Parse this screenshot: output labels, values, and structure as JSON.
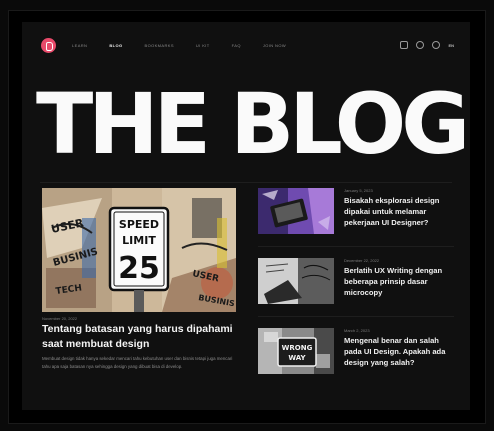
{
  "nav": {
    "logo_letter": "",
    "items": [
      {
        "label": "LEARN",
        "active": false
      },
      {
        "label": "BLOG",
        "active": true
      },
      {
        "label": "BOOKMARKS",
        "active": false
      },
      {
        "label": "UI KIT",
        "active": false
      },
      {
        "label": "FAQ",
        "active": false
      },
      {
        "label": "JOIN NOW",
        "active": false
      }
    ],
    "lang": "EN",
    "social_icons": [
      "twitter-icon",
      "instagram-icon",
      "dribbble-icon"
    ]
  },
  "hero": {
    "title": "THE BLOG"
  },
  "featured": {
    "image_sign_top": "SPEED",
    "image_sign_mid": "LIMIT",
    "image_sign_num": "25",
    "date": "November 20, 2022",
    "title": "Tentang batasan yang harus dipahami saat membuat design",
    "excerpt": "Membuat design tidak hanya sekedar mencari tahu kebutuhan user dan bisnis tetapi juga mencari tahu apa saja batasan nya sehingga design yang dibuat bisa di develop."
  },
  "articles": [
    {
      "date": "January 5, 2023",
      "title": "Bisakah eksplorasi design dipakai untuk melamar pekerjaan UI Designer?"
    },
    {
      "date": "December 22, 2022",
      "title": "Berlatih UX Writing dengan beberapa prinsip dasar microcopy"
    },
    {
      "date": "March 2, 2023",
      "title": "Mengenal benar dan salah pada UI Design. Apakah ada design yang salah?",
      "image_sign": "WRONG WAY"
    }
  ],
  "colors": {
    "accent": "#e84a6a",
    "background": "#101010",
    "text": "#f4f4f4",
    "muted": "#8c8c8c"
  }
}
